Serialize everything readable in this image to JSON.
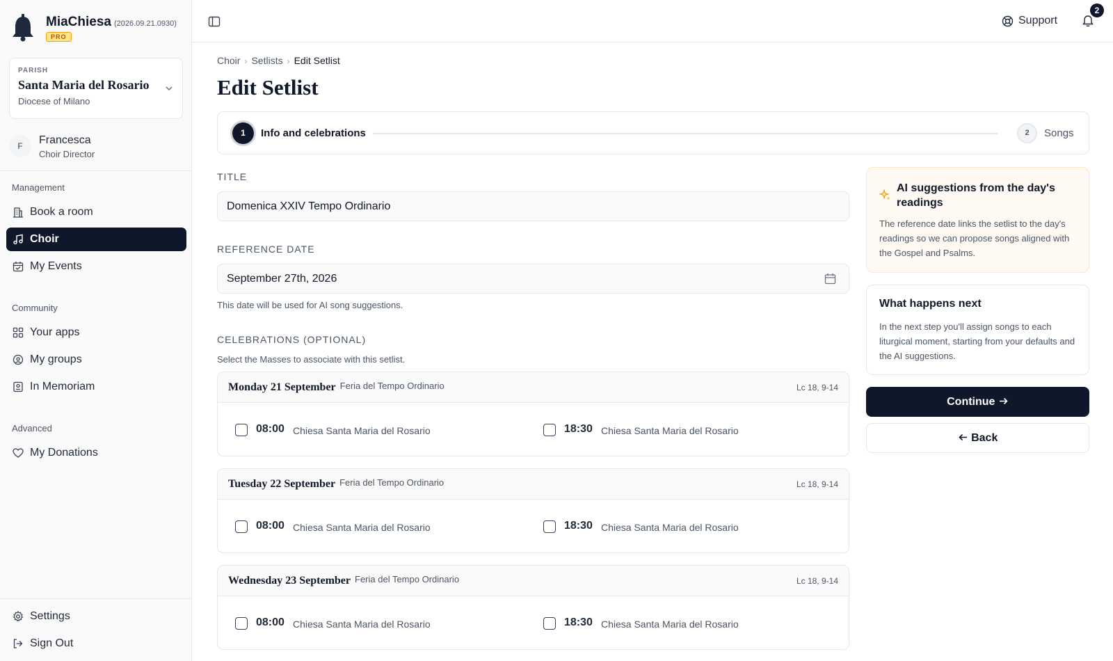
{
  "app": {
    "name": "MiaChiesa",
    "version": "(2026.09.21.0930)",
    "tier": "PRO"
  },
  "parish": {
    "label": "PARISH",
    "name": "Santa Maria del Rosario",
    "diocese": "Diocese of Milano"
  },
  "user": {
    "initial": "F",
    "name": "Francesca",
    "role": "Choir Director"
  },
  "sidebar": {
    "sections": [
      {
        "label": "Management",
        "items": [
          {
            "label": "Book a room",
            "icon": "building-icon"
          },
          {
            "label": "Choir",
            "icon": "music-note-icon",
            "active": true
          },
          {
            "label": "My Events",
            "icon": "calendar-icon"
          }
        ]
      },
      {
        "label": "Community",
        "items": [
          {
            "label": "Your apps",
            "icon": "grid-icon"
          },
          {
            "label": "My groups",
            "icon": "groups-icon"
          },
          {
            "label": "In Memoriam",
            "icon": "memorial-icon"
          }
        ]
      },
      {
        "label": "Advanced",
        "items": [
          {
            "label": "My Donations",
            "icon": "heart-icon"
          }
        ]
      }
    ],
    "footer": [
      {
        "label": "Settings",
        "icon": "gear-icon"
      },
      {
        "label": "Sign Out",
        "icon": "sign-out-icon"
      }
    ]
  },
  "topbar": {
    "support_label": "Support",
    "notifications_count": "2"
  },
  "breadcrumb": [
    "Choir",
    "Setlists",
    "Edit Setlist"
  ],
  "page": {
    "title": "Edit Setlist"
  },
  "stepper": {
    "steps": [
      {
        "number": "1",
        "label": "Info and celebrations",
        "active": true
      },
      {
        "number": "2",
        "label": "Songs",
        "active": false
      }
    ]
  },
  "form": {
    "title_label": "TITLE",
    "title_value": "Domenica XXIV Tempo Ordinario",
    "date_label": "REFERENCE DATE",
    "date_value": "September 27th, 2026",
    "date_hint": "This date will be used for AI song suggestions.",
    "celebrations_label": "CELEBRATIONS (OPTIONAL)",
    "celebrations_hint": "Select the Masses to associate with this setlist."
  },
  "days": [
    {
      "name": "Monday 21 September",
      "feria": "Feria del Tempo Ordinario",
      "reading": "Lc 18, 9-14",
      "masses": [
        {
          "time": "08:00",
          "church": "Chiesa Santa Maria del Rosario",
          "checked": false
        },
        {
          "time": "18:30",
          "church": "Chiesa Santa Maria del Rosario",
          "checked": false
        }
      ]
    },
    {
      "name": "Tuesday 22 September",
      "feria": "Feria del Tempo Ordinario",
      "reading": "Lc 18, 9-14",
      "masses": [
        {
          "time": "08:00",
          "church": "Chiesa Santa Maria del Rosario",
          "checked": false
        },
        {
          "time": "18:30",
          "church": "Chiesa Santa Maria del Rosario",
          "checked": false
        }
      ]
    },
    {
      "name": "Wednesday 23 September",
      "feria": "Feria del Tempo Ordinario",
      "reading": "Lc 18, 9-14",
      "masses": [
        {
          "time": "08:00",
          "church": "Chiesa Santa Maria del Rosario",
          "checked": false
        },
        {
          "time": "18:30",
          "church": "Chiesa Santa Maria del Rosario",
          "checked": false
        }
      ]
    }
  ],
  "ai_card": {
    "title": "AI suggestions from the day's readings",
    "body": "The reference date links the setlist to the day's readings so we can propose songs aligned with the Gospel and Psalms."
  },
  "next_card": {
    "title": "What happens next",
    "body": "In the next step you'll assign songs to each liturgical moment, starting from your defaults and the AI suggestions."
  },
  "actions": {
    "continue_label": "Continue",
    "back_label": "Back"
  },
  "colors": {
    "primary": "#0f172a",
    "ai_accent": "#f59e0b",
    "ai_background": "#fefaf3"
  }
}
